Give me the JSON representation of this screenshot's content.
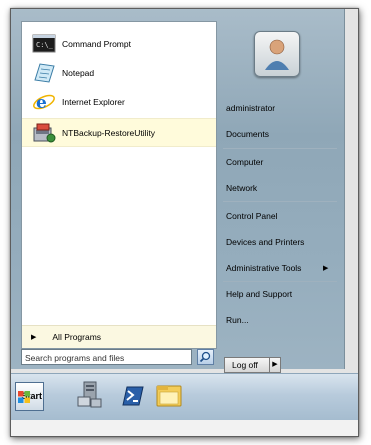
{
  "start_menu": {
    "pinned_programs": [
      {
        "label": "Command Prompt",
        "icon": "command-prompt-icon"
      },
      {
        "label": "Notepad",
        "icon": "notepad-icon"
      },
      {
        "label": "Internet Explorer",
        "icon": "internet-explorer-icon"
      },
      {
        "label": "NTBackup-RestoreUtility",
        "icon": "ntbackup-icon",
        "highlighted": true
      }
    ],
    "all_programs_label": "All Programs",
    "search": {
      "placeholder": "Search programs and files"
    },
    "right_items": [
      "administrator",
      "Documents",
      "Computer",
      "Network",
      "Control Panel",
      "Devices and Printers",
      "Administrative Tools",
      "Help and Support",
      "Run..."
    ],
    "logoff_label": "Log off"
  },
  "taskbar": {
    "start_label": "Start",
    "pinned_icons": [
      "server-manager-icon",
      "powershell-icon",
      "windows-explorer-icon"
    ]
  },
  "colors": {
    "highlight": "#fffbdb",
    "glass": "#9db3c2",
    "taskbar": "#b8cbdc"
  }
}
